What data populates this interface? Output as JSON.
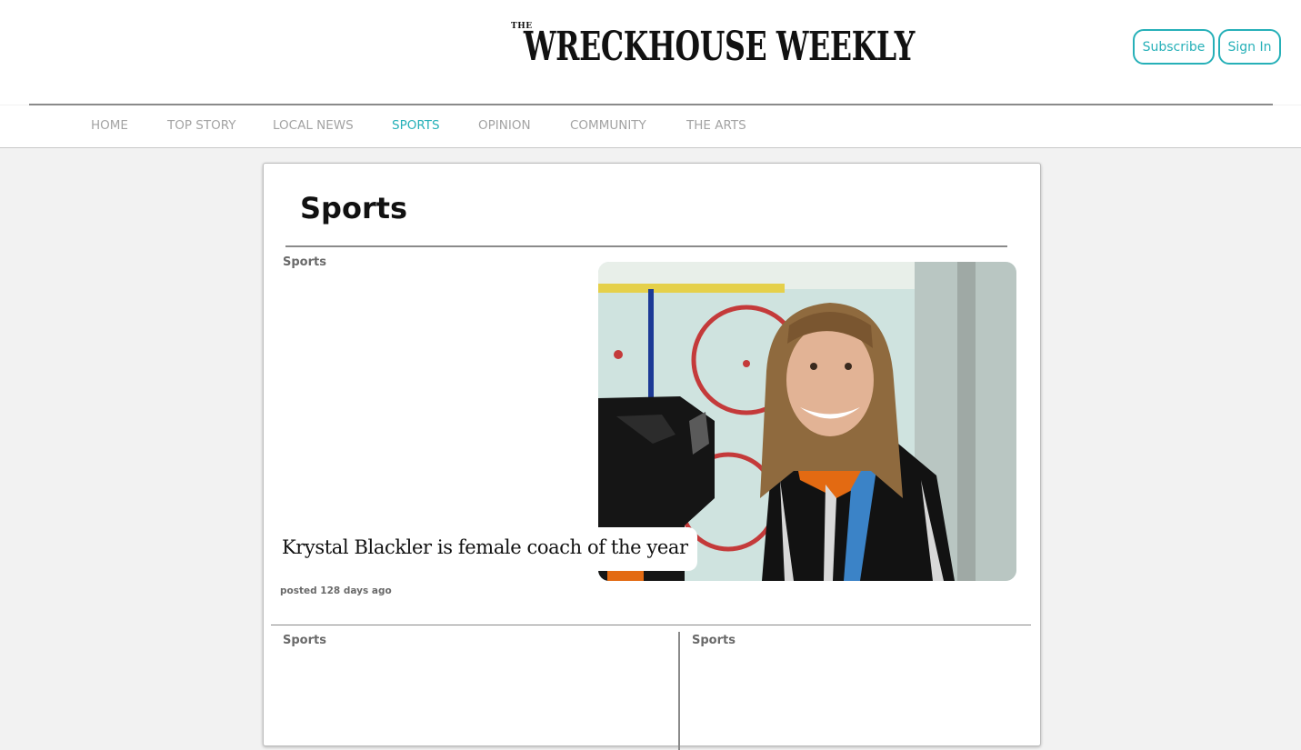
{
  "masthead": {
    "the": "THE",
    "name": "WRECKHOUSE WEEKLY"
  },
  "header": {
    "subscribe_label": "Subscribe",
    "signin_label": "Sign In"
  },
  "nav": {
    "items": [
      {
        "label": "HOME",
        "active": false
      },
      {
        "label": "TOP STORY",
        "active": false
      },
      {
        "label": "LOCAL NEWS",
        "active": false
      },
      {
        "label": "SPORTS",
        "active": true
      },
      {
        "label": "OPINION",
        "active": false
      },
      {
        "label": "COMMUNITY",
        "active": false
      },
      {
        "label": "THE ARTS",
        "active": false
      }
    ]
  },
  "main": {
    "section_title": "Sports",
    "featured": {
      "kicker": "Sports",
      "headline": "Krystal Blackler is female coach of the year",
      "posted": "posted 128 days ago"
    },
    "secondary": [
      {
        "kicker": "Sports"
      },
      {
        "kicker": "Sports"
      }
    ]
  },
  "colors": {
    "accent": "#26b0b8",
    "nav_inactive": "#a3a3a3",
    "page_background": "#f2f2f2"
  }
}
